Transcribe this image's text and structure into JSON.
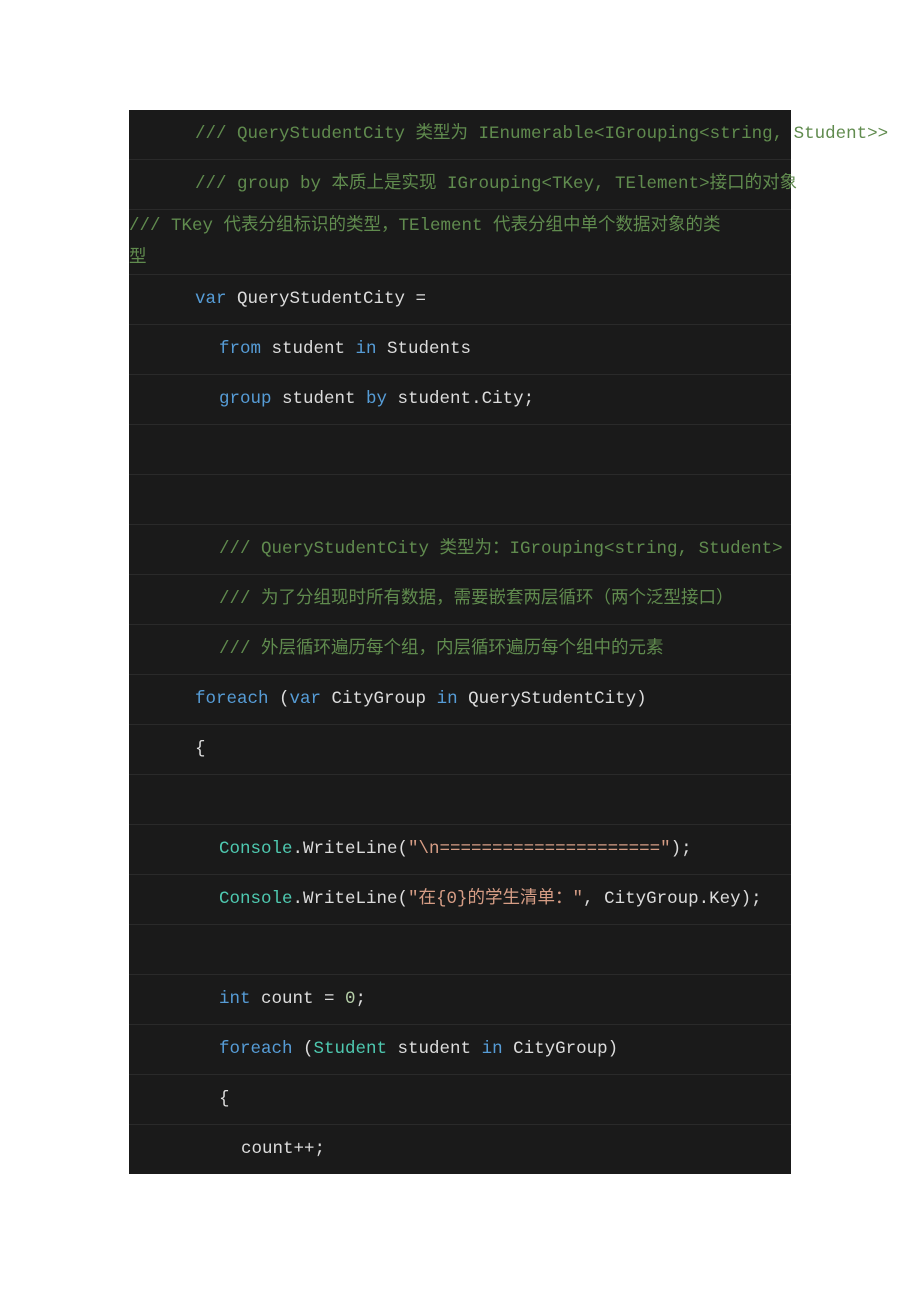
{
  "code": {
    "lines": [
      {
        "id": 0,
        "indent": 1,
        "wrapped": false,
        "tokens": [
          {
            "t": "/// QueryStudentCity 类型为 IEnumerable<IGrouping<string, Student>>",
            "c": "comment"
          }
        ]
      },
      {
        "id": 1,
        "indent": 1,
        "wrapped": false,
        "tokens": [
          {
            "t": "/// group by 本质上是实现 IGrouping<TKey, TElement>接口的对象",
            "c": "comment"
          }
        ]
      },
      {
        "id": 2,
        "indent": 0,
        "wrapped": true,
        "tokens_a": [
          {
            "t": "            /// TKey 代表分组标识的类型，TElement 代表分组中单个数据对象的类",
            "c": "comment"
          }
        ],
        "tokens_b": [
          {
            "t": "型",
            "c": "comment"
          }
        ]
      },
      {
        "id": 3,
        "indent": 1,
        "wrapped": false,
        "tokens": [
          {
            "t": "var",
            "c": "keyword"
          },
          {
            "t": " QueryStudentCity =",
            "c": "plain"
          }
        ]
      },
      {
        "id": 4,
        "indent": 2,
        "wrapped": false,
        "tokens": [
          {
            "t": "from",
            "c": "keyword"
          },
          {
            "t": " student ",
            "c": "plain"
          },
          {
            "t": "in",
            "c": "keyword"
          },
          {
            "t": " Students",
            "c": "plain"
          }
        ]
      },
      {
        "id": 5,
        "indent": 2,
        "wrapped": false,
        "tokens": [
          {
            "t": "group",
            "c": "keyword"
          },
          {
            "t": " student ",
            "c": "plain"
          },
          {
            "t": "by",
            "c": "keyword"
          },
          {
            "t": " student",
            "c": "plain"
          },
          {
            "t": ".",
            "c": "plain"
          },
          {
            "t": "City;",
            "c": "plain"
          }
        ]
      },
      {
        "id": 6,
        "indent": 0,
        "wrapped": false,
        "tokens": []
      },
      {
        "id": 7,
        "indent": 0,
        "wrapped": false,
        "tokens": []
      },
      {
        "id": 8,
        "indent": 2,
        "wrapped": false,
        "tokens": [
          {
            "t": "/// QueryStudentCity 类型为：IGrouping<string, Student>",
            "c": "comment"
          }
        ]
      },
      {
        "id": 9,
        "indent": 2,
        "wrapped": false,
        "tokens": [
          {
            "t": "/// 为了分组现时所有数据，需要嵌套两层循环（两个泛型接口）",
            "c": "comment"
          }
        ]
      },
      {
        "id": 10,
        "indent": 2,
        "wrapped": false,
        "tokens": [
          {
            "t": "/// 外层循环遍历每个组，内层循环遍历每个组中的元素",
            "c": "comment"
          }
        ]
      },
      {
        "id": 11,
        "indent": 1,
        "wrapped": false,
        "tokens": [
          {
            "t": "foreach",
            "c": "keyword"
          },
          {
            "t": " (",
            "c": "plain"
          },
          {
            "t": "var",
            "c": "keyword"
          },
          {
            "t": " CityGroup ",
            "c": "plain"
          },
          {
            "t": "in",
            "c": "keyword"
          },
          {
            "t": " QueryStudentCity)",
            "c": "plain"
          }
        ]
      },
      {
        "id": 12,
        "indent": 1,
        "wrapped": false,
        "tokens": [
          {
            "t": "{",
            "c": "plain"
          }
        ]
      },
      {
        "id": 13,
        "indent": 0,
        "wrapped": false,
        "tokens": []
      },
      {
        "id": 14,
        "indent": 2,
        "wrapped": false,
        "tokens": [
          {
            "t": "Console",
            "c": "type"
          },
          {
            "t": ".WriteLine(",
            "c": "plain"
          },
          {
            "t": "\"\\n=====================\"",
            "c": "string-lit"
          },
          {
            "t": ");",
            "c": "plain"
          }
        ]
      },
      {
        "id": 15,
        "indent": 2,
        "wrapped": false,
        "tokens": [
          {
            "t": "Console",
            "c": "type"
          },
          {
            "t": ".WriteLine(",
            "c": "plain"
          },
          {
            "t": "\"在{0}的学生清单：\"",
            "c": "string-lit"
          },
          {
            "t": ", CityGroup",
            "c": "plain"
          },
          {
            "t": ".",
            "c": "plain"
          },
          {
            "t": "Key);",
            "c": "plain"
          }
        ]
      },
      {
        "id": 16,
        "indent": 0,
        "wrapped": false,
        "tokens": []
      },
      {
        "id": 17,
        "indent": 2,
        "wrapped": false,
        "tokens": [
          {
            "t": "int",
            "c": "keyword"
          },
          {
            "t": " count = ",
            "c": "plain"
          },
          {
            "t": "0",
            "c": "number"
          },
          {
            "t": ";",
            "c": "plain"
          }
        ]
      },
      {
        "id": 18,
        "indent": 2,
        "wrapped": false,
        "tokens": [
          {
            "t": "foreach",
            "c": "keyword"
          },
          {
            "t": " (",
            "c": "plain"
          },
          {
            "t": "Student",
            "c": "type"
          },
          {
            "t": " student ",
            "c": "plain"
          },
          {
            "t": "in",
            "c": "keyword"
          },
          {
            "t": " CityGroup)",
            "c": "plain"
          }
        ]
      },
      {
        "id": 19,
        "indent": 2,
        "wrapped": false,
        "tokens": [
          {
            "t": "{",
            "c": "plain"
          }
        ]
      },
      {
        "id": 20,
        "indent": 3,
        "wrapped": false,
        "tokens": [
          {
            "t": "count++;",
            "c": "plain"
          }
        ]
      }
    ]
  }
}
